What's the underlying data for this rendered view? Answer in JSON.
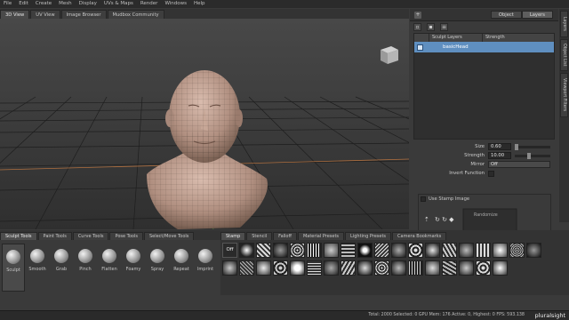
{
  "menu": [
    "File",
    "Edit",
    "Create",
    "Mesh",
    "Display",
    "UVs & Maps",
    "Render",
    "Windows",
    "Help"
  ],
  "view_tabs": [
    "3D View",
    "UV View",
    "Image Browser",
    "Mudbox Community"
  ],
  "right_panel": {
    "toggle": [
      "Object",
      "Layers"
    ],
    "add_icon": "+",
    "layers_header": {
      "name": "Sculpt Layers",
      "strength": "Strength"
    },
    "layer_row": {
      "name": "basicHead"
    }
  },
  "side_tabs": [
    "Layers",
    "Object List",
    "Viewport Filters"
  ],
  "properties": {
    "size_label": "Size",
    "size_value": "0.60",
    "strength_label": "Strength",
    "strength_value": "10.00",
    "mirror_label": "Mirror",
    "mirror_value": "Off",
    "invert_label": "Invert Function"
  },
  "stamp": {
    "use_label": "Use Stamp Image",
    "randomize_label": "Randomize",
    "flip_label": "Horizontal Flip"
  },
  "tool_tabs": [
    "Sculpt Tools",
    "Paint Tools",
    "Curve Tools",
    "Pose Tools",
    "Select/Move Tools"
  ],
  "tools": [
    "Sculpt",
    "Smooth",
    "Grab",
    "Pinch",
    "Flatten",
    "Foamy",
    "Spray",
    "Repeat",
    "Imprint"
  ],
  "tray_tabs": [
    "Stamp",
    "Stencil",
    "Falloff",
    "Material Presets",
    "Lighting Presets",
    "Camera Bookmarks"
  ],
  "stamp_off": "Off",
  "status_text": "Total: 2000  Selected: 0  GPU Mem: 176  Active: 0, Highest: 0  FPS: 593.138",
  "brand": "pluralsight",
  "mesh_color": "#b8998a",
  "accent_color": "#5f8fc0"
}
